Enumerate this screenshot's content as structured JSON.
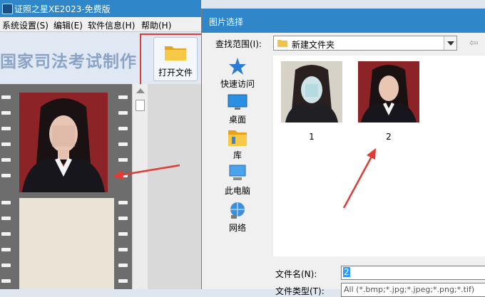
{
  "app": {
    "title": "证照之星XE2023-免费版",
    "menus": [
      "系统设置(S)",
      "编辑(E)",
      "软件信息(H)",
      "帮助(H)"
    ],
    "banner_title": "国家司法考试制作",
    "open_file_label": "打开文件"
  },
  "dialog": {
    "title": "图片选择",
    "look_in_label": "查找范围(I):",
    "look_in_value": "新建文件夹",
    "places": [
      {
        "label": "快速访问",
        "icon": "star-icon"
      },
      {
        "label": "桌面",
        "icon": "desktop-icon"
      },
      {
        "label": "库",
        "icon": "library-icon"
      },
      {
        "label": "此电脑",
        "icon": "computer-icon"
      },
      {
        "label": "网络",
        "icon": "network-icon"
      }
    ],
    "files": [
      {
        "label": "1"
      },
      {
        "label": "2"
      }
    ],
    "file_name_label": "文件名(N):",
    "file_name_value": "2",
    "file_type_label": "文件类型(T):",
    "file_type_value": "All (*.bmp;*.jpg;*.jpeg;*.png;*.tif)"
  },
  "colors": {
    "titlebar": "#2f86c9",
    "annotation": "#e53935",
    "photo_background": "#8c2327"
  }
}
